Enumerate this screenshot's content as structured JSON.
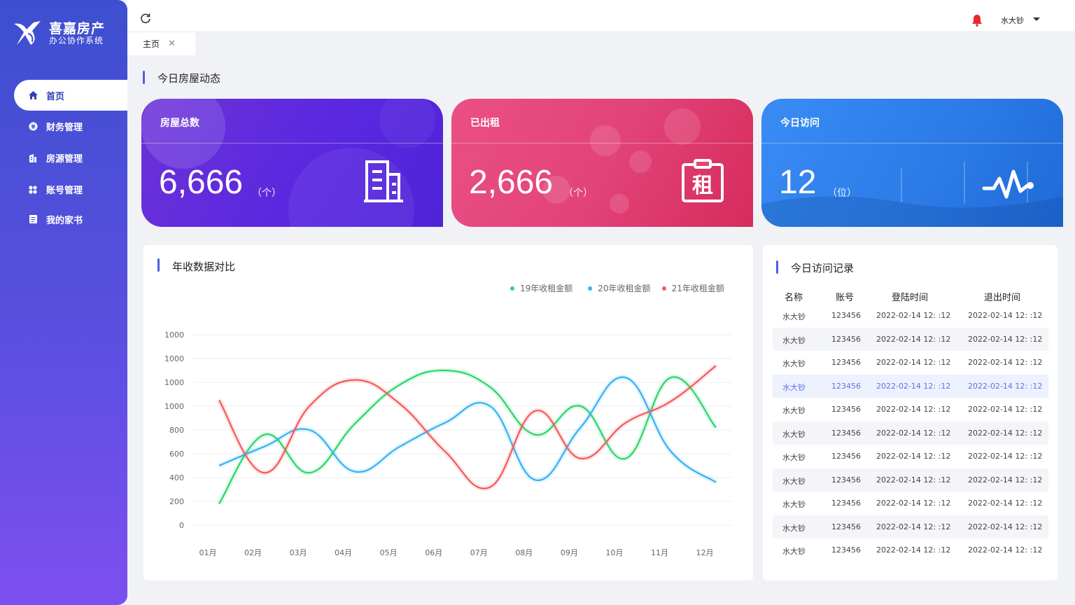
{
  "app": {
    "title": "喜嘉房产",
    "subtitle": "办公协作系统"
  },
  "sidebar": {
    "items": [
      {
        "label": "首页",
        "icon": "home-icon",
        "active": true
      },
      {
        "label": "财务管理",
        "icon": "yen-icon"
      },
      {
        "label": "房源管理",
        "icon": "building-icon"
      },
      {
        "label": "账号管理",
        "icon": "grid-icon"
      },
      {
        "label": "我的家书",
        "icon": "book-icon"
      }
    ]
  },
  "header": {
    "user_name": "水大钞"
  },
  "tabs": [
    {
      "label": "主页",
      "close": "✕"
    }
  ],
  "today": {
    "title": "今日房屋动态",
    "cards": [
      {
        "label": "房屋总数",
        "value": "6,666",
        "unit": "（个）",
        "icon": "building-icon"
      },
      {
        "label": "已出租",
        "value": "2,666",
        "unit": "（个）",
        "icon": "rent-clipboard-icon"
      },
      {
        "label": "今日访问",
        "value": "12",
        "unit": "（位）",
        "icon": "pulse-icon"
      }
    ]
  },
  "chart_panel": {
    "title": "年收数据对比"
  },
  "chart_data": {
    "type": "line",
    "title": "年收数据对比",
    "categories": [
      "01月",
      "02月",
      "03月",
      "04月",
      "05月",
      "06月",
      "07月",
      "08月",
      "09月",
      "10月",
      "11月",
      "12月"
    ],
    "y_tick_labels": [
      "0",
      "200",
      "400",
      "600",
      "800",
      "1000",
      "1000",
      "1000",
      "1000"
    ],
    "ylim": [
      0,
      1600
    ],
    "grid": true,
    "legend_position": "top-right",
    "series": [
      {
        "name": "19年收租金额",
        "color": "#2ad66a",
        "values": [
          180,
          760,
          440,
          850,
          1180,
          1300,
          1160,
          760,
          1000,
          560,
          1240,
          820
        ]
      },
      {
        "name": "20年收租金额",
        "color": "#35b2f5",
        "values": [
          500,
          660,
          800,
          450,
          660,
          860,
          1000,
          380,
          820,
          1240,
          620,
          360
        ]
      },
      {
        "name": "21年收租金额",
        "color": "#f45a5a",
        "values": [
          1050,
          440,
          1000,
          1220,
          1020,
          620,
          320,
          960,
          560,
          860,
          1040,
          1340
        ]
      }
    ]
  },
  "visits": {
    "title": "今日访问记录",
    "columns": [
      "名称",
      "账号",
      "登陆时间",
      "退出时间"
    ],
    "rows": [
      [
        "水大钞",
        "123456",
        "2022-02-14 12: :12",
        "2022-02-14 12: :12"
      ],
      [
        "水大钞",
        "123456",
        "2022-02-14 12: :12",
        "2022-02-14 12: :12"
      ],
      [
        "水大钞",
        "123456",
        "2022-02-14 12: :12",
        "2022-02-14 12: :12"
      ],
      [
        "水大钞",
        "123456",
        "2022-02-14 12: :12",
        "2022-02-14 12: :12"
      ],
      [
        "水大钞",
        "123456",
        "2022-02-14 12: :12",
        "2022-02-14 12: :12"
      ],
      [
        "水大钞",
        "123456",
        "2022-02-14 12: :12",
        "2022-02-14 12: :12"
      ],
      [
        "水大钞",
        "123456",
        "2022-02-14 12: :12",
        "2022-02-14 12: :12"
      ],
      [
        "水大钞",
        "123456",
        "2022-02-14 12: :12",
        "2022-02-14 12: :12"
      ],
      [
        "水大钞",
        "123456",
        "2022-02-14 12: :12",
        "2022-02-14 12: :12"
      ],
      [
        "水大钞",
        "123456",
        "2022-02-14 12: :12",
        "2022-02-14 12: :12"
      ],
      [
        "水大钞",
        "123456",
        "2022-02-14 12: :12",
        "2022-02-14 12: :12"
      ]
    ]
  },
  "colors": {
    "accent": "#4b5ee8",
    "sidebar_top": "#3d4fcf",
    "sidebar_bottom": "#7d4ff0",
    "bell": "#e8262b"
  }
}
